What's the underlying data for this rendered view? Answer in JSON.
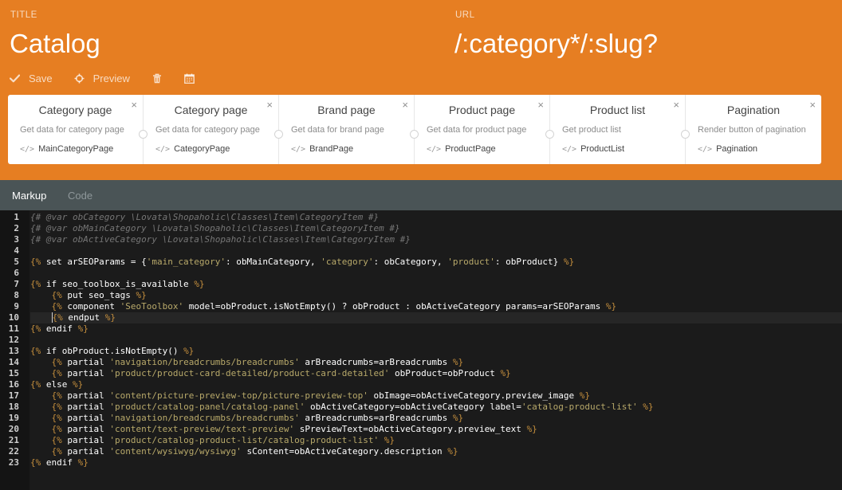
{
  "header": {
    "title_label": "TITLE",
    "title_value": "Catalog",
    "url_label": "URL",
    "url_value": "/:category*/:slug?"
  },
  "toolbar": {
    "save_label": "Save",
    "preview_label": "Preview",
    "save_icon": "check-icon",
    "preview_icon": "crosshair-icon",
    "delete_icon": "trash-icon",
    "date_icon": "calendar-icon"
  },
  "components": [
    {
      "name": "Category page",
      "description": "Get data for category page",
      "alias": "MainCategoryPage"
    },
    {
      "name": "Category page",
      "description": "Get data for category page",
      "alias": "CategoryPage"
    },
    {
      "name": "Brand page",
      "description": "Get data for brand page",
      "alias": "BrandPage"
    },
    {
      "name": "Product page",
      "description": "Get data for product page",
      "alias": "ProductPage"
    },
    {
      "name": "Product list",
      "description": "Get product list",
      "alias": "ProductList"
    },
    {
      "name": "Pagination",
      "description": "Render button of pagination",
      "alias": "Pagination"
    }
  ],
  "components_close_glyph": "×",
  "components_alias_glyph": "</>",
  "tabs": [
    {
      "label": "Markup",
      "active": true
    },
    {
      "label": "Code",
      "active": false
    }
  ],
  "colors": {
    "header_bg": "#e67e22",
    "tabs_bg": "#4a5456",
    "editor_bg": "#1b1b1b",
    "gutter_bg": "#141414",
    "twig_tag": "#c58f3d",
    "string": "#b8a96a",
    "comment": "#767676"
  },
  "editor": {
    "active_line": 10,
    "lines": [
      [
        [
          "comment",
          "{# @var obCategory \\Lovata\\Shopaholic\\Classes\\Item\\CategoryItem #}"
        ]
      ],
      [
        [
          "comment",
          "{# @var obMainCategory \\Lovata\\Shopaholic\\Classes\\Item\\CategoryItem #}"
        ]
      ],
      [
        [
          "comment",
          "{# @var obActiveCategory \\Lovata\\Shopaholic\\Classes\\Item\\CategoryItem #}"
        ]
      ],
      [],
      [
        [
          "tag",
          "{%"
        ],
        [
          "kw",
          " set arSEOParams = {"
        ],
        [
          "str",
          "'main_category'"
        ],
        [
          "kw",
          ": obMainCategory, "
        ],
        [
          "str",
          "'category'"
        ],
        [
          "kw",
          ": obCategory, "
        ],
        [
          "str",
          "'product'"
        ],
        [
          "kw",
          ": obProduct} "
        ],
        [
          "tag",
          "%}"
        ]
      ],
      [],
      [
        [
          "tag",
          "{%"
        ],
        [
          "kw",
          " if seo_toolbox_is_available "
        ],
        [
          "tag",
          "%}"
        ]
      ],
      [
        [
          "plain",
          "    "
        ],
        [
          "tag",
          "{%"
        ],
        [
          "kw",
          " put seo_tags "
        ],
        [
          "tag",
          "%}"
        ]
      ],
      [
        [
          "plain",
          "    "
        ],
        [
          "tag",
          "{%"
        ],
        [
          "kw",
          " component "
        ],
        [
          "str",
          "'SeoToolbox'"
        ],
        [
          "kw",
          " model=obProduct.isNotEmpty() ? obProduct : obActiveCategory params=arSEOParams "
        ],
        [
          "tag",
          "%}"
        ]
      ],
      [
        [
          "plain",
          "    "
        ],
        [
          "cursor",
          ""
        ],
        [
          "tag",
          "{%"
        ],
        [
          "kw",
          " endput "
        ],
        [
          "tag",
          "%}"
        ]
      ],
      [
        [
          "tag",
          "{%"
        ],
        [
          "kw",
          " endif "
        ],
        [
          "tag",
          "%}"
        ]
      ],
      [],
      [
        [
          "tag",
          "{%"
        ],
        [
          "kw",
          " if obProduct.isNotEmpty() "
        ],
        [
          "tag",
          "%}"
        ]
      ],
      [
        [
          "plain",
          "    "
        ],
        [
          "tag",
          "{%"
        ],
        [
          "kw",
          " partial "
        ],
        [
          "str",
          "'navigation/breadcrumbs/breadcrumbs'"
        ],
        [
          "kw",
          " arBreadcrumbs=arBreadcrumbs "
        ],
        [
          "tag",
          "%}"
        ]
      ],
      [
        [
          "plain",
          "    "
        ],
        [
          "tag",
          "{%"
        ],
        [
          "kw",
          " partial "
        ],
        [
          "str",
          "'product/product-card-detailed/product-card-detailed'"
        ],
        [
          "kw",
          " obProduct=obProduct "
        ],
        [
          "tag",
          "%}"
        ]
      ],
      [
        [
          "tag",
          "{%"
        ],
        [
          "kw",
          " else "
        ],
        [
          "tag",
          "%}"
        ]
      ],
      [
        [
          "plain",
          "    "
        ],
        [
          "tag",
          "{%"
        ],
        [
          "kw",
          " partial "
        ],
        [
          "str",
          "'content/picture-preview-top/picture-preview-top'"
        ],
        [
          "kw",
          " obImage=obActiveCategory.preview_image "
        ],
        [
          "tag",
          "%}"
        ]
      ],
      [
        [
          "plain",
          "    "
        ],
        [
          "tag",
          "{%"
        ],
        [
          "kw",
          " partial "
        ],
        [
          "str",
          "'product/catalog-panel/catalog-panel'"
        ],
        [
          "kw",
          " obActiveCategory=obActiveCategory label="
        ],
        [
          "str",
          "'catalog-product-list'"
        ],
        [
          "kw",
          " "
        ],
        [
          "tag",
          "%}"
        ]
      ],
      [
        [
          "plain",
          "    "
        ],
        [
          "tag",
          "{%"
        ],
        [
          "kw",
          " partial "
        ],
        [
          "str",
          "'navigation/breadcrumbs/breadcrumbs'"
        ],
        [
          "kw",
          " arBreadcrumbs=arBreadcrumbs "
        ],
        [
          "tag",
          "%}"
        ]
      ],
      [
        [
          "plain",
          "    "
        ],
        [
          "tag",
          "{%"
        ],
        [
          "kw",
          " partial "
        ],
        [
          "str",
          "'content/text-preview/text-preview'"
        ],
        [
          "kw",
          " sPreviewText=obActiveCategory.preview_text "
        ],
        [
          "tag",
          "%}"
        ]
      ],
      [
        [
          "plain",
          "    "
        ],
        [
          "tag",
          "{%"
        ],
        [
          "kw",
          " partial "
        ],
        [
          "str",
          "'product/catalog-product-list/catalog-product-list'"
        ],
        [
          "kw",
          " "
        ],
        [
          "tag",
          "%}"
        ]
      ],
      [
        [
          "plain",
          "    "
        ],
        [
          "tag",
          "{%"
        ],
        [
          "kw",
          " partial "
        ],
        [
          "str",
          "'content/wysiwyg/wysiwyg'"
        ],
        [
          "kw",
          " sContent=obActiveCategory.description "
        ],
        [
          "tag",
          "%}"
        ]
      ],
      [
        [
          "tag",
          "{%"
        ],
        [
          "kw",
          " endif "
        ],
        [
          "tag",
          "%}"
        ]
      ]
    ]
  }
}
